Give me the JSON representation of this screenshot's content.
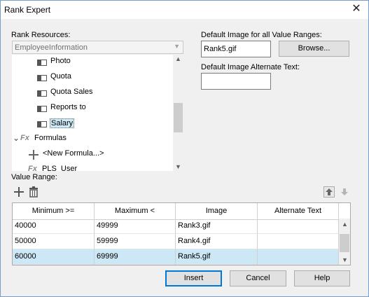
{
  "dialog": {
    "title": "Rank Expert",
    "close_glyph": "✕"
  },
  "left": {
    "rank_resources_label": "Rank Resources:",
    "combo_value": "EmployeeInformation",
    "tree": [
      {
        "label": "Photo",
        "icon": "field-icon"
      },
      {
        "label": "Quota",
        "icon": "field-icon"
      },
      {
        "label": "Quota Sales",
        "icon": "field-icon"
      },
      {
        "label": "Reports to",
        "icon": "field-icon"
      },
      {
        "label": "Salary",
        "icon": "field-icon",
        "selected": true
      },
      {
        "label": "Formulas",
        "icon": "formula-icon",
        "expander": "⌄"
      },
      {
        "label": "<New Formula...>",
        "icon": "plus-icon"
      },
      {
        "label": "PLS_User",
        "icon": "formula-icon"
      }
    ],
    "fx_glyph": "Fx"
  },
  "right": {
    "default_image_label": "Default Image for all Value Ranges:",
    "default_image_value": "Rank5.gif",
    "browse_label": "Browse...",
    "alt_text_label": "Default Image Alternate Text:",
    "alt_text_value": ""
  },
  "value_range": {
    "label": "Value Range:",
    "columns": [
      "Minimum >=",
      "Maximum <",
      "Image",
      "Alternate Text"
    ],
    "rows": [
      {
        "min": "40000",
        "max": "49999",
        "image": "Rank3.gif",
        "alt": ""
      },
      {
        "min": "50000",
        "max": "59999",
        "image": "Rank4.gif",
        "alt": ""
      },
      {
        "min": "60000",
        "max": "69999",
        "image": "Rank5.gif",
        "alt": "",
        "selected": true
      }
    ]
  },
  "buttons": {
    "insert": "Insert",
    "cancel": "Cancel",
    "help": "Help"
  },
  "colors": {
    "selection": "#cce8f6",
    "accent": "#0078d7"
  }
}
